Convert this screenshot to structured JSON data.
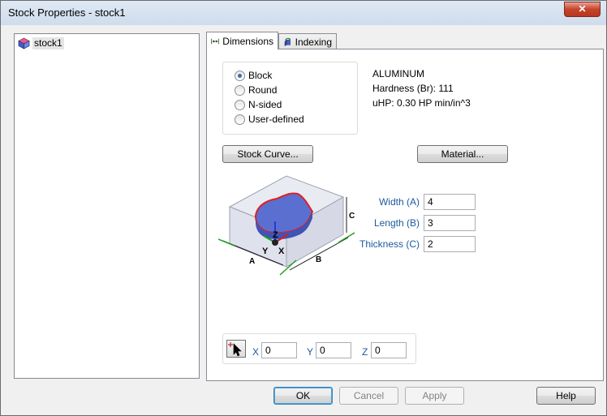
{
  "window": {
    "title": "Stock Properties - stock1",
    "close_label": "✕"
  },
  "tree": {
    "items": [
      {
        "label": "stock1",
        "icon": "stock-cube-icon"
      }
    ]
  },
  "tabs": [
    {
      "label": "Dimensions",
      "icon": "dimensions-arrows-icon",
      "active": true
    },
    {
      "label": "Indexing",
      "icon": "indexing-rotate-icon",
      "active": false
    }
  ],
  "shape": {
    "options": [
      "Block",
      "Round",
      "N-sided",
      "User-defined"
    ],
    "selected": "Block"
  },
  "material_info": {
    "name": "ALUMINUM",
    "hardness_label": "Hardness (Br):",
    "hardness_value": "111",
    "uhp": "uHP: 0.30 HP min/in^3"
  },
  "buttons": {
    "stock_curve": "Stock Curve...",
    "material": "Material...",
    "ok": "OK",
    "cancel": "Cancel",
    "apply": "Apply",
    "help": "Help"
  },
  "dimensions": {
    "width_label": "Width (A)",
    "width": "4",
    "length_label": "Length (B)",
    "length": "3",
    "thickness_label": "Thickness (C)",
    "thickness": "2"
  },
  "diagram": {
    "label_a": "A",
    "label_b": "B",
    "label_c": "C",
    "axis_x": "X",
    "axis_y": "Y",
    "axis_z": "Z"
  },
  "origin": {
    "x_label": "X",
    "x": "0",
    "y_label": "Y",
    "y": "0",
    "z_label": "Z",
    "z": "0"
  },
  "colors": {
    "accent_blue": "#1c5a9c",
    "stock_fill": "#5a6fd0",
    "stock_outline": "#e02020"
  }
}
